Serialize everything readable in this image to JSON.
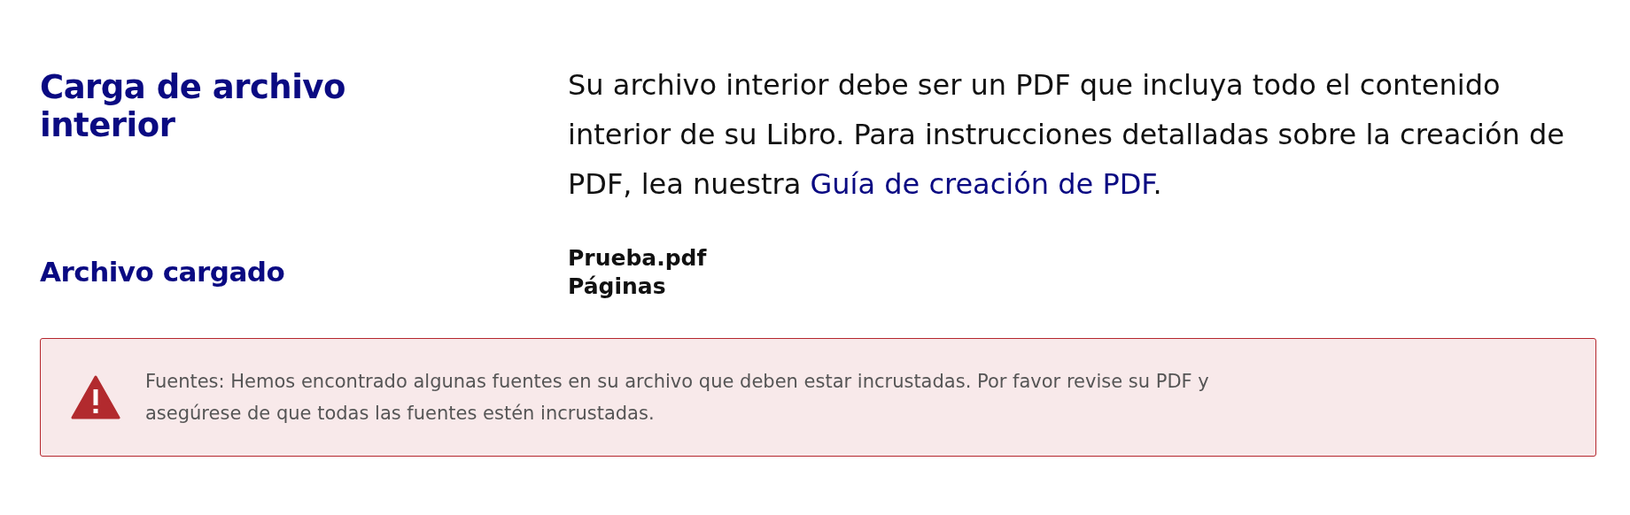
{
  "sections": [
    {
      "heading": "Carga de archivo interior",
      "kind": "paragraph",
      "text": "Su archivo interior debe ser un PDF que incluya todo el contenido interior de su Libro. Para instrucciones detalladas sobre la creación de PDF, lea nuestra",
      "link": "Guía de creación de PDF",
      "after_link": "."
    },
    {
      "heading": "Archivo cargado",
      "kind": "file",
      "lines": [
        "Prueba.pdf",
        "Páginas"
      ]
    }
  ],
  "alert": {
    "text": "Fuentes: Hemos encontrado algunas fuentes en su archivo que deben estar incrustadas. Por favor revise su PDF y asegúrese de que todas las fuentes estén incrustadas."
  }
}
